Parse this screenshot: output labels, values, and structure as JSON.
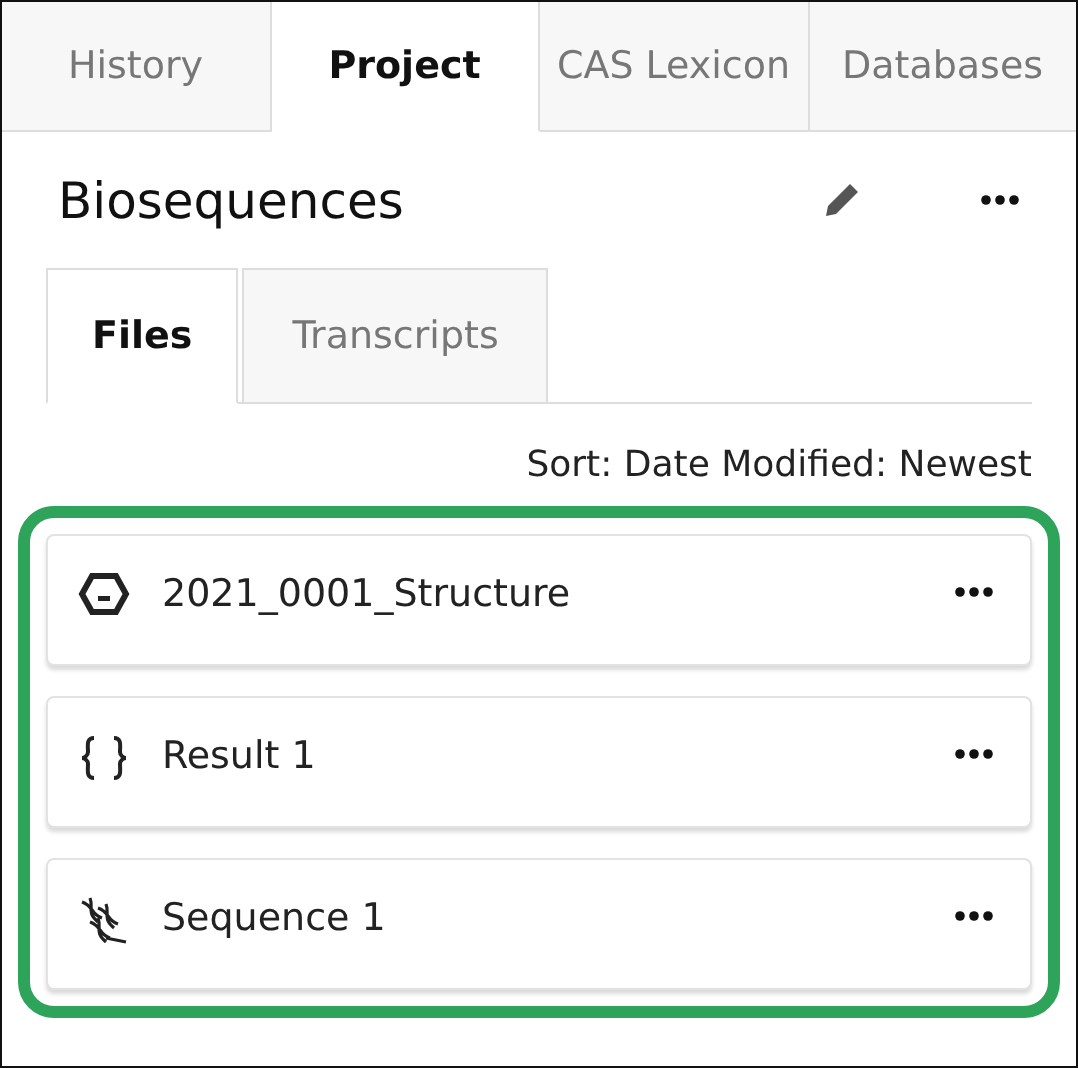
{
  "tabs": [
    {
      "label": "History",
      "selected": false
    },
    {
      "label": "Project",
      "selected": true
    },
    {
      "label": "CAS Lexicon",
      "selected": false
    },
    {
      "label": "Databases",
      "selected": false
    }
  ],
  "title": "Biosequences",
  "subtabs": [
    {
      "label": "Files",
      "selected": true
    },
    {
      "label": "Transcripts",
      "selected": false
    }
  ],
  "sort": "Sort: Date Modified: Newest",
  "files": [
    {
      "kind": "structure",
      "name": "2021_0001_Structure"
    },
    {
      "kind": "result",
      "name": "Result 1"
    },
    {
      "kind": "sequence",
      "name": "Sequence 1"
    }
  ]
}
